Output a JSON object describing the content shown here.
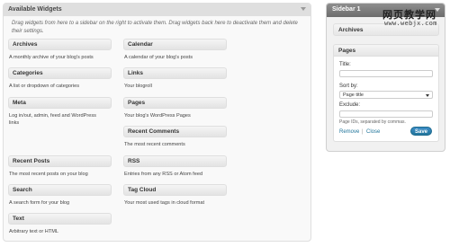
{
  "available": {
    "title": "Available Widgets",
    "description": "Drag widgets from here to a sidebar on the right to activate them. Drag widgets back here to deactivate them and delete their settings.",
    "widgets": [
      {
        "title": "Archives",
        "desc": "A monthly archive of your blog's posts"
      },
      {
        "title": "Calendar",
        "desc": "A calendar of your blog's posts"
      },
      {
        "title": "Categories",
        "desc": "A list or dropdown of categories"
      },
      {
        "title": "Links",
        "desc": "Your blogroll"
      },
      {
        "title": "Meta",
        "desc": "Log in/out, admin, feed and WordPress links"
      },
      {
        "title": "Pages",
        "desc": "Your blog's WordPress Pages"
      },
      {
        "title": "Recent Comments",
        "desc": "The most recent comments"
      },
      {
        "title": "Recent Posts",
        "desc": "The most recent posts on your blog"
      },
      {
        "title": "RSS",
        "desc": "Entries from any RSS or Atom feed"
      },
      {
        "title": "Search",
        "desc": "A search form for your blog"
      },
      {
        "title": "Tag Cloud",
        "desc": "Your most used tags in cloud format"
      },
      {
        "title": "Text",
        "desc": "Arbitrary text or HTML"
      }
    ]
  },
  "sidebar": {
    "title": "Sidebar 1",
    "archives_title": "Archives",
    "pages_widget": {
      "title": "Pages",
      "title_label": "Title:",
      "title_value": "",
      "sort_label": "Sort by:",
      "sort_value": "Page title",
      "exclude_label": "Exclude:",
      "exclude_value": "",
      "note": "Page IDs, separated by commas.",
      "remove_label": "Remove",
      "separator": "|",
      "close_label": "Close",
      "save_label": "Save"
    }
  },
  "watermark": {
    "line1": "网页教学网",
    "line2": "www.webjx.com"
  }
}
